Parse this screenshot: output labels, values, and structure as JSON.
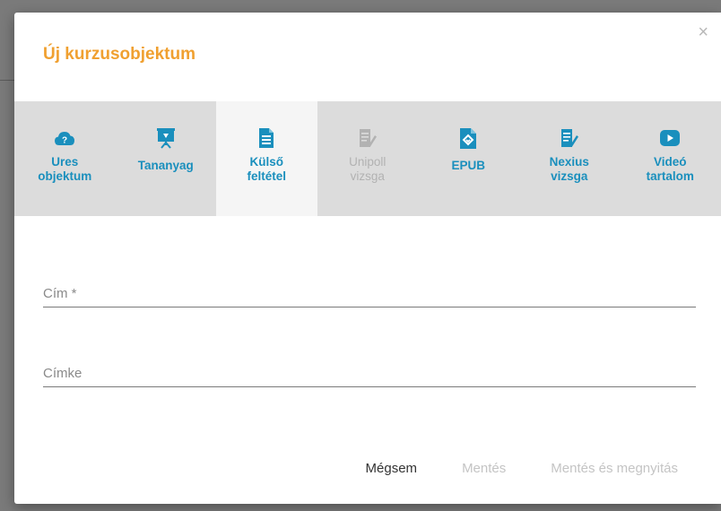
{
  "dialog": {
    "title": "Új kurzusobjektum",
    "close_symbol": "×"
  },
  "tabs": [
    {
      "label": "Ures\nobjektum",
      "icon": "cloud-question-icon",
      "state": "normal"
    },
    {
      "label": "Tananyag",
      "icon": "presentation-board-icon",
      "state": "normal"
    },
    {
      "label": "Külső\nfeltétel",
      "icon": "document-lines-icon",
      "state": "active"
    },
    {
      "label": "Unipoll\nvizsga",
      "icon": "document-pencil-icon",
      "state": "disabled"
    },
    {
      "label": "EPUB",
      "icon": "epub-book-icon",
      "state": "normal"
    },
    {
      "label": "Nexius\nvizsga",
      "icon": "document-pencil-icon",
      "state": "normal"
    },
    {
      "label": "Videó\ntartalom",
      "icon": "play-icon",
      "state": "normal"
    }
  ],
  "form": {
    "title_placeholder": "Cím *",
    "title_value": "",
    "label_placeholder": "Címke",
    "label_value": ""
  },
  "actions": {
    "cancel": "Mégsem",
    "save": "Mentés",
    "save_and_open": "Mentés és megnyitás"
  },
  "colors": {
    "accent_title": "#f0a030",
    "tab_text": "#1a8fbd",
    "disabled_text": "#b2b2b2"
  }
}
